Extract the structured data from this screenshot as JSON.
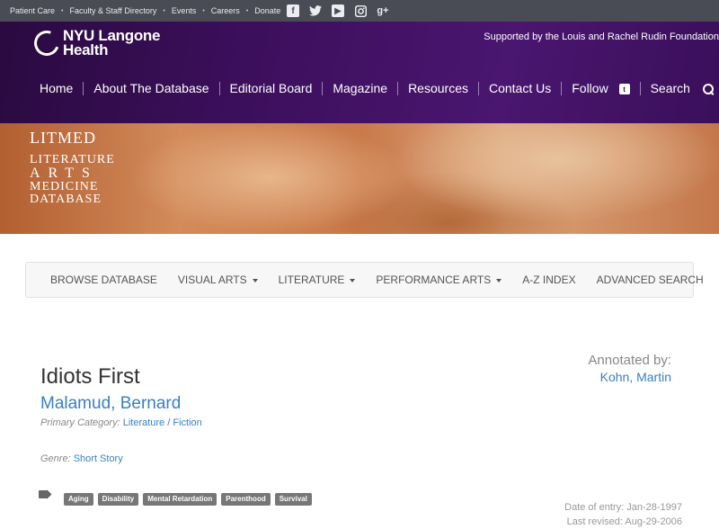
{
  "utility": {
    "links": [
      "Patient Care",
      "Faculty & Staff Directory",
      "Events",
      "Careers",
      "Donate"
    ],
    "social_icons": [
      "facebook-icon",
      "twitter-icon",
      "youtube-icon",
      "instagram-icon",
      "google-plus-icon"
    ]
  },
  "header": {
    "logo_line1": "NYU Langone",
    "logo_line2": "Health",
    "supported_by": "Supported by the Louis and Rachel Rudin Foundation",
    "nav": [
      "Home",
      "About The Database",
      "Editorial Board",
      "Magazine",
      "Resources",
      "Contact Us"
    ],
    "follow_label": "Follow",
    "search_label": "Search"
  },
  "banner": {
    "line1": "LITMED",
    "line2": "LITERATURE",
    "line3": "ARTS",
    "line4": "MEDICINE",
    "line5": "DATABASE"
  },
  "subnav": {
    "browse": "BROWSE DATABASE",
    "visual_arts": "VISUAL ARTS",
    "literature": "LITERATURE",
    "performance_arts": "PERFORMANCE ARTS",
    "az_index": "A-Z INDEX",
    "advanced_search": "ADVANCED SEARCH"
  },
  "entry": {
    "title": "Idiots First",
    "author": "Malamud, Bernard",
    "primary_category_label": "Primary Category:",
    "category_main": "Literature",
    "category_sep": " / ",
    "category_sub": "Fiction",
    "genre_label": "Genre:",
    "genre": "Short Story",
    "annotated_by_label": "Annotated by:",
    "annotator": "Kohn, Martin",
    "tags": [
      "Aging",
      "Disability",
      "Mental Retardation",
      "Parenthood",
      "Survival"
    ],
    "date_of_entry": "Date of entry: Jan-28-1997",
    "last_revised": "Last revised: Aug-29-2006"
  }
}
